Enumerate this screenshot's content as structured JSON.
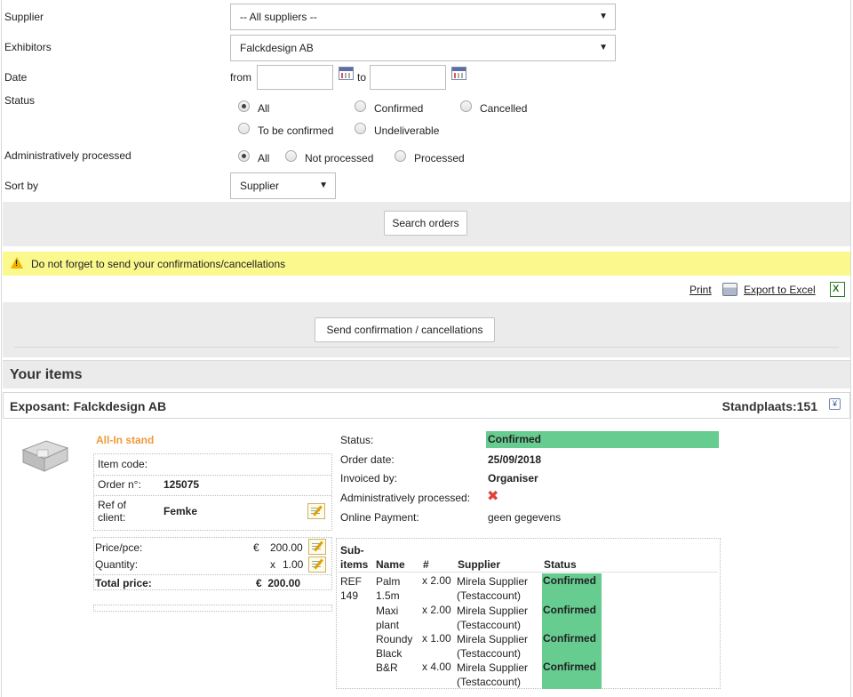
{
  "filters": {
    "supplier_label": "Supplier",
    "supplier_value": "-- All suppliers --",
    "exhibitors_label": "Exhibitors",
    "exhibitors_value": "Falckdesign AB",
    "date_label": "Date",
    "date_from_label": "from",
    "date_to_label": "to",
    "date_from_value": "",
    "date_to_value": "",
    "status_label": "Status",
    "status_options": [
      "All",
      "Confirmed",
      "Cancelled",
      "To be confirmed",
      "Undeliverable"
    ],
    "status_selected": "All",
    "admin_label": "Administratively processed",
    "admin_options": [
      "All",
      "Not processed",
      "Processed"
    ],
    "admin_selected": "All",
    "sort_label": "Sort by",
    "sort_value": "Supplier",
    "search_button": "Search orders"
  },
  "notice": "Do not forget to send your confirmations/cancellations",
  "actions": {
    "print": "Print",
    "export": "Export to Excel",
    "send_button": "Send confirmation / cancellations"
  },
  "items_title": "Your items",
  "exhibitor": {
    "title": "Exposant: Falckdesign AB",
    "stand": "Standplaats:151"
  },
  "item": {
    "name": "All-In stand",
    "item_code_label": "Item code:",
    "item_code": "",
    "order_no_label": "Order n°:",
    "order_no": "125075",
    "ref_label": "Ref of client:",
    "ref_value": "Femke",
    "price_label": "Price/pce:",
    "price_currency": "€",
    "price_value": "200.00",
    "quantity_label": "Quantity:",
    "quantity_prefix": "x",
    "quantity_value": "1.00",
    "total_label": "Total price:",
    "total_value": "€  200.00"
  },
  "order": {
    "status_label": "Status:",
    "status_value": "Confirmed",
    "status_color": "#66cc8f",
    "date_label": "Order date:",
    "date_value": "25/09/2018",
    "invoiced_label": "Invoiced by:",
    "invoiced_value": "Organiser",
    "admin_label": "Administratively processed:",
    "payment_label": "Online Payment:",
    "payment_value": "geen gegevens"
  },
  "subitems": {
    "headers": [
      "Sub-items",
      "Name",
      "#",
      "Supplier",
      "Status"
    ],
    "ref": "REF 149",
    "rows": [
      {
        "name": "Palm 1.5m",
        "qty": "x 2.00",
        "supplier": "Mirela Supplier (Testaccount)",
        "status": "Confirmed"
      },
      {
        "name": "Maxi plant",
        "qty": "x 2.00",
        "supplier": "Mirela Supplier (Testaccount)",
        "status": "Confirmed"
      },
      {
        "name": "Roundy Black",
        "qty": "x 1.00",
        "supplier": "Mirela Supplier (Testaccount)",
        "status": "Confirmed"
      },
      {
        "name": "B&R",
        "qty": "x 4.00",
        "supplier": "Mirela Supplier (Testaccount)",
        "status": "Confirmed"
      }
    ]
  },
  "icons": {
    "calendar": "calendar-icon",
    "warning": "warning-icon",
    "printer": "printer-icon",
    "excel": "excel-icon",
    "edit": "edit-icon",
    "collapse": "collapse-icon",
    "cross": "cross-icon"
  }
}
